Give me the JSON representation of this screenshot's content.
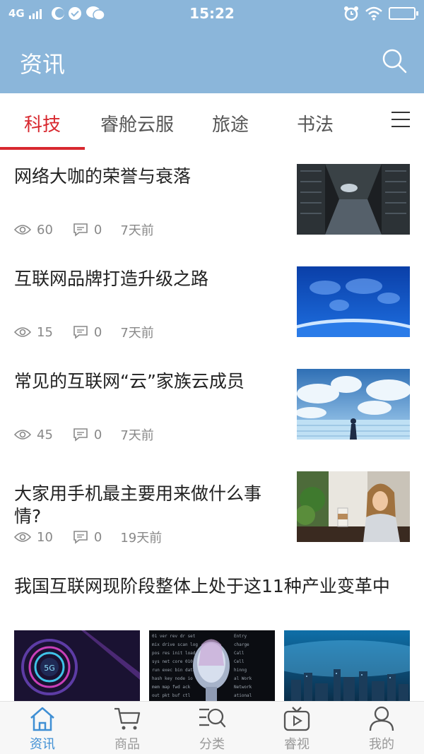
{
  "status_bar": {
    "network": "4G",
    "time": "15:22"
  },
  "header": {
    "title": "资讯"
  },
  "tabs": [
    {
      "label": "科技",
      "active": true
    },
    {
      "label": "睿舱云服",
      "active": false
    },
    {
      "label": "旅途",
      "active": false
    },
    {
      "label": "书法",
      "active": false
    }
  ],
  "news": [
    {
      "title": "网络大咖的荣誉与衰落",
      "views": "60",
      "comments": "0",
      "time": "7天前",
      "thumb": "server-room"
    },
    {
      "title": "互联网品牌打造升级之路",
      "views": "15",
      "comments": "0",
      "time": "7天前",
      "thumb": "digital-earth"
    },
    {
      "title": "常见的互联网“云”家族云成员",
      "views": "45",
      "comments": "0",
      "time": "7天前",
      "thumb": "cloud-sky"
    },
    {
      "title": "大家用手机最主要用来做什么事情?",
      "views": "10",
      "comments": "0",
      "time": "19天前",
      "thumb": "woman-phone"
    },
    {
      "title": "我国互联网现阶段整体上处于这11种产业变革中",
      "images": [
        "5g-ring",
        "ai-face",
        "city-night"
      ]
    }
  ],
  "bottom_nav": [
    {
      "label": "资讯",
      "icon": "home-icon",
      "active": true
    },
    {
      "label": "商品",
      "icon": "cart-icon",
      "active": false
    },
    {
      "label": "分类",
      "icon": "category-search-icon",
      "active": false
    },
    {
      "label": "睿视",
      "icon": "tv-icon",
      "active": false
    },
    {
      "label": "我的",
      "icon": "user-icon",
      "active": false
    }
  ],
  "colors": {
    "header_bg": "#8bb6da",
    "tab_active": "#d8282f",
    "nav_active": "#3f8fd4",
    "meta_text": "#888888"
  }
}
